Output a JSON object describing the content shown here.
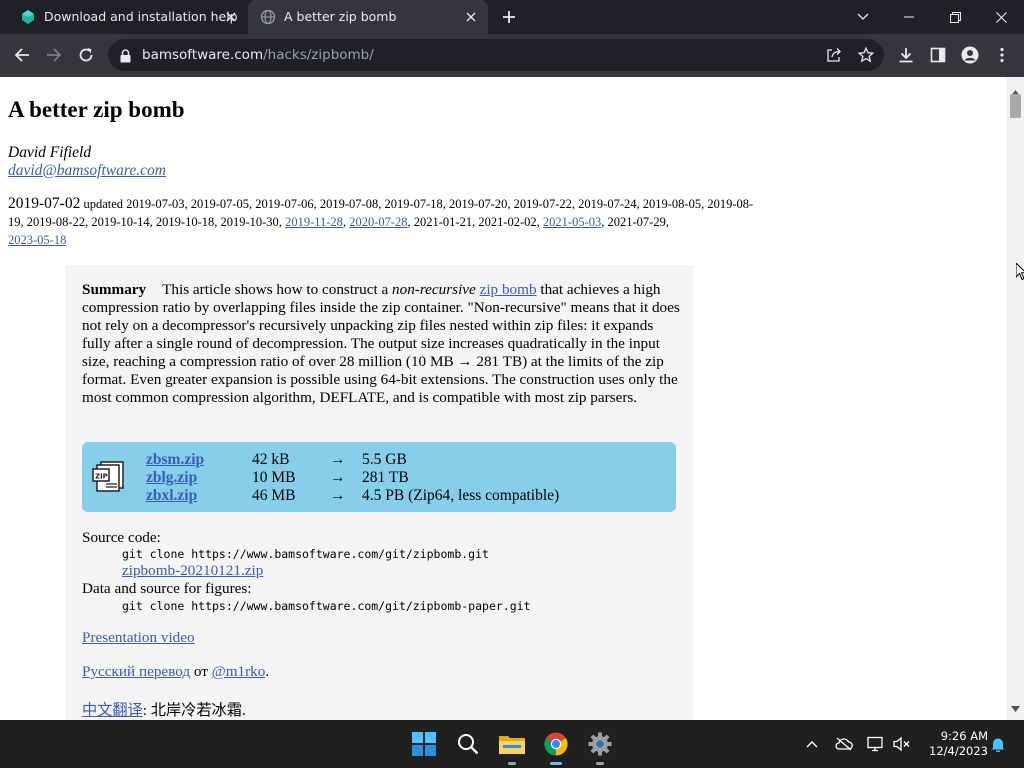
{
  "tabs": [
    {
      "title": "Download and installation help",
      "favicon": "blue-gem-icon",
      "active": false
    },
    {
      "title": "A better zip bomb",
      "favicon": "globe-icon",
      "active": true
    }
  ],
  "toolbar": {
    "url_host": "bamsoftware.com",
    "url_path": "/hacks/zipbomb/"
  },
  "page": {
    "title": "A better zip bomb",
    "author": "David Fifield",
    "email": "david@bamsoftware.com",
    "date": "2019-07-02",
    "updated_label": "updated",
    "updates_line1": "2019-07-03, 2019-07-05, 2019-07-06, 2019-07-08, 2019-07-18, 2019-07-20, 2019-07-22, 2019-07-24, 2019-08-05,",
    "updates_line2_plain": "2019-08-19, 2019-08-22, 2019-10-14, 2019-10-18, 2019-10-30,",
    "update_link_1": "2019-11-28",
    "update_link_2": "2020-07-28",
    "updates_line2_mid": "2021-01-21, 2021-02-02,",
    "update_link_3": "2021-05-03",
    "updates_line2_end": "2021-07-29,",
    "update_link_4": "2023-05-18",
    "summary": {
      "heading": "Summary",
      "text_1": "This article shows how to construct a",
      "text_em": "non-recursive",
      "link": "zip bomb",
      "text_2": "that achieves a high compression ratio by overlapping files inside the zip container. \"Non-recursive\" means that it does not rely on a decompressor's recursively unpacking zip files nested within zip files: it expands fully after a single round of decompression. The output size increases quadratically in the input size, reaching a compression ratio of over 28 million (10 MB → 281 TB) at the limits of the zip format. Even greater expansion is possible using 64-bit extensions. The construction uses only the most common compression algorithm, DEFLATE, and is compatible with most zip parsers."
    },
    "files": [
      {
        "name": "zbsm.zip",
        "compressed": "42 kB",
        "arrow": "→",
        "uncompressed": "5.5 GB"
      },
      {
        "name": "zblg.zip",
        "compressed": "10 MB",
        "arrow": "→",
        "uncompressed": "281 TB"
      },
      {
        "name": "zbxl.zip",
        "compressed": "46 MB",
        "arrow": "→",
        "uncompressed": "4.5 PB (Zip64, less compatible)"
      }
    ],
    "source_label": "Source code:",
    "source_cmd": "git clone https://www.bamsoftware.com/git/zipbomb.git",
    "source_zip": "zipbomb-20210121.zip",
    "figures_label": "Data and source for figures:",
    "figures_cmd": "git clone https://www.bamsoftware.com/git/zipbomb-paper.git",
    "video_link": "Presentation video",
    "ru_link": "Русский перевод",
    "ru_from": "от",
    "ru_author": "@m1rko",
    "ru_end": ".",
    "zh_link": "中文翻译",
    "zh_rest": ": 北岸冷若冰霜."
  },
  "taskbar": {
    "apps": [
      "windows-start-icon",
      "search-icon",
      "file-explorer-icon",
      "chrome-icon",
      "settings-gear-icon"
    ],
    "time": "9:26 AM",
    "date": "12/4/2023"
  },
  "colors": {
    "tab_bg": "#202124",
    "toolbar_bg": "#35363a",
    "link": "#3b5bb5",
    "files_box": "#87ceeb",
    "summary_bg": "#f4f4f4",
    "taskbar_bg": "#202020",
    "taskbar_active": "#76b9ed"
  }
}
